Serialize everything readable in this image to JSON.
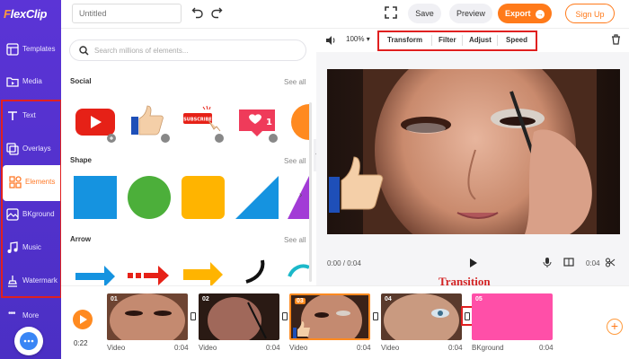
{
  "app": {
    "logo_main": "FlexClip",
    "logo_f": "F",
    "logo_rest": "lexClip"
  },
  "sidebar": {
    "items": [
      {
        "label": "Templates"
      },
      {
        "label": "Media"
      },
      {
        "label": "Text"
      },
      {
        "label": "Overlays"
      },
      {
        "label": "Elements"
      },
      {
        "label": "BKground"
      },
      {
        "label": "Music"
      },
      {
        "label": "Watermark"
      }
    ],
    "more_label": "More",
    "active_color": "#ff7a29"
  },
  "topbar": {
    "title_placeholder": "Untitled",
    "save_label": "Save",
    "preview_label": "Preview",
    "export_label": "Export",
    "signup_label": "Sign Up"
  },
  "panel": {
    "search_placeholder": "Search millions of elements...",
    "sections": [
      {
        "title": "Social",
        "see_all": "See all"
      },
      {
        "title": "Shape",
        "see_all": "See all"
      },
      {
        "title": "Arrow",
        "see_all": "See all"
      }
    ]
  },
  "preview": {
    "zoom": "100%",
    "tools": [
      "Transform",
      "Filter",
      "Adjust",
      "Speed"
    ],
    "current_time": "0:00 / 0:04",
    "clip_duration": "0:04"
  },
  "annotation": {
    "transition_label": "Transition"
  },
  "timeline": {
    "time": "0:22",
    "clips": [
      {
        "num": "01",
        "label": "Video",
        "duration": "0:04"
      },
      {
        "num": "02",
        "label": "Video",
        "duration": "0:04"
      },
      {
        "num": "03",
        "label": "Video",
        "duration": "0:04"
      },
      {
        "num": "04",
        "label": "Video",
        "duration": "0:04"
      },
      {
        "num": "05",
        "label": "BKground",
        "duration": "0:04"
      }
    ]
  },
  "colors": {
    "brand_purple": "#5b34d6",
    "accent_orange": "#ff7a1a",
    "highlight_red": "#e02020",
    "bkground_pink": "#ff4fa8"
  }
}
